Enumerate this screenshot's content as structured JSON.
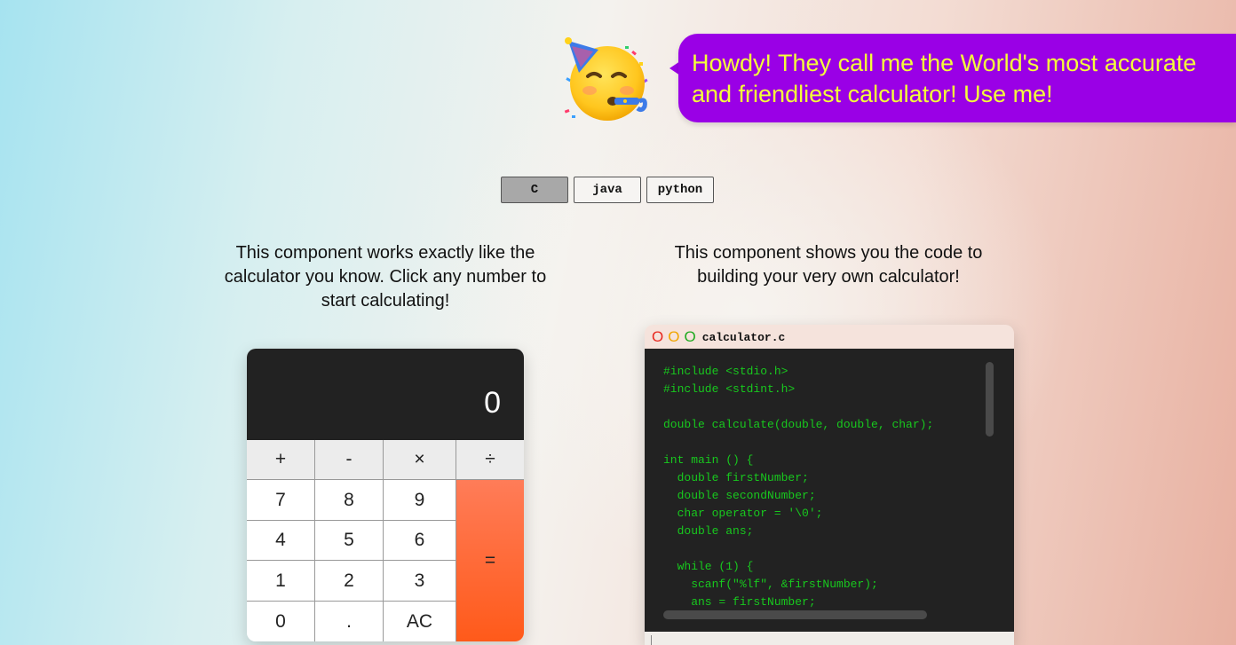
{
  "header": {
    "mascot_icon": "partying-face-icon",
    "speech": "Howdy! They call me the World's most accurate and friendliest calculator! Use me!",
    "bubble_color": "#9a00e6",
    "bubble_text_color": "#f4ff3a"
  },
  "languages": {
    "tabs": [
      {
        "label": "C",
        "active": true
      },
      {
        "label": "java",
        "active": false
      },
      {
        "label": "python",
        "active": false
      }
    ]
  },
  "calculator_section": {
    "description": "This component works exactly like the calculator you know. Click any number to start calculating!"
  },
  "code_section": {
    "description": "This component shows you the code to building your very own calculator!"
  },
  "calculator": {
    "display": "0",
    "keys": {
      "plus": "+",
      "minus": "-",
      "times": "×",
      "divide": "÷",
      "seven": "7",
      "eight": "8",
      "nine": "9",
      "four": "4",
      "five": "5",
      "six": "6",
      "one": "1",
      "two": "2",
      "three": "3",
      "zero": "0",
      "dot": ".",
      "clear": "AC",
      "equals": "="
    },
    "equals_color": "#ff6a3a"
  },
  "code_window": {
    "dots": [
      "O",
      "O",
      "O"
    ],
    "dot_colors": [
      "#e8281f",
      "#f0a500",
      "#1faa1f"
    ],
    "filename": "calculator.c",
    "code": "#include <stdio.h>\n#include <stdint.h>\n\ndouble calculate(double, double, char);\n\nint main () {\n  double firstNumber;\n  double secondNumber;\n  char operator = '\\0';\n  double ans;\n\n  while (1) {\n    scanf(\"%lf\", &firstNumber);\n    ans = firstNumber;",
    "code_color": "#18c81e"
  }
}
